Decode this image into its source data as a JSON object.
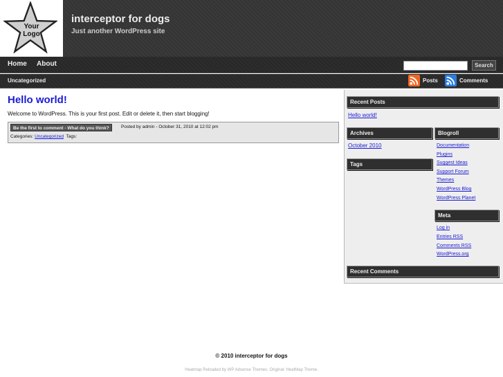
{
  "header": {
    "logo_line1": "Your",
    "logo_line2": "Logo",
    "site_title": "interceptor for dogs",
    "site_description": "Just another WordPress site"
  },
  "nav": {
    "items": [
      "Home",
      "About"
    ],
    "search_button": "Search",
    "search_value": ""
  },
  "category_bar": {
    "category": "Uncategorized",
    "feeds": [
      "Posts",
      "Comments"
    ]
  },
  "post": {
    "title": "Hello world!",
    "body": "Welcome to WordPress. This is your first post. Edit or delete it, then start blogging!",
    "comment_link": "Be the first to comment - What do you think?",
    "posted_by": "Posted by admin - October 31, 2010 at 12:02 pm",
    "categories_label": "Categories:",
    "category": "Uncategorized",
    "tags_label": "Tags:"
  },
  "sidebar": {
    "recent_posts": {
      "title": "Recent Posts",
      "items": [
        "Hello world!"
      ]
    },
    "archives": {
      "title": "Archives",
      "items": [
        "October 2010"
      ]
    },
    "tags": {
      "title": "Tags"
    },
    "blogroll": {
      "title": "Blogroll",
      "items": [
        "Documentation",
        "Plugins",
        "Suggest Ideas",
        "Support Forum",
        "Themes",
        "WordPress Blog",
        "WordPress Planet"
      ]
    },
    "meta": {
      "title": "Meta",
      "items": [
        "Log in",
        "Entries RSS",
        "Comments RSS",
        "WordPress.org"
      ]
    },
    "recent_comments": {
      "title": "Recent Comments"
    }
  },
  "footer": {
    "copyright": "© 2010 interceptor for dogs",
    "credit": "Heatmap Reloaded by WP Adsense Themes. Original: HeatMap Theme."
  },
  "colors": {
    "link": "#1a1ad4",
    "header_bg": "#3a3a3a",
    "rss": "#f26522"
  },
  "icons": {
    "logo": "star-icon",
    "feed": "rss-icon"
  }
}
